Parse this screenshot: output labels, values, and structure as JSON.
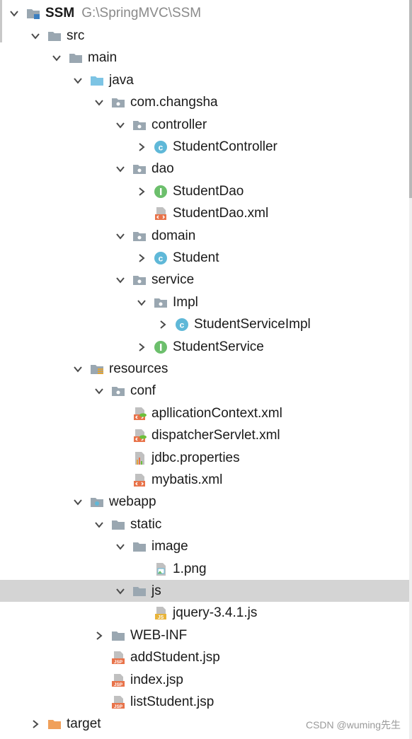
{
  "project": {
    "name": "SSM",
    "path": "G:\\SpringMVC\\SSM"
  },
  "tree": [
    {
      "label": "src",
      "depth": 1,
      "state": "open",
      "icon": "folder-icon"
    },
    {
      "label": "main",
      "depth": 2,
      "state": "open",
      "icon": "folder-icon"
    },
    {
      "label": "java",
      "depth": 3,
      "state": "open",
      "icon": "source-folder-icon"
    },
    {
      "label": "com.changsha",
      "depth": 4,
      "state": "open",
      "icon": "package-icon"
    },
    {
      "label": "controller",
      "depth": 5,
      "state": "open",
      "icon": "package-icon"
    },
    {
      "label": "StudentController",
      "depth": 6,
      "state": "closed",
      "icon": "class-icon"
    },
    {
      "label": "dao",
      "depth": 5,
      "state": "open",
      "icon": "package-icon"
    },
    {
      "label": "StudentDao",
      "depth": 6,
      "state": "closed",
      "icon": "interface-icon"
    },
    {
      "label": "StudentDao.xml",
      "depth": 6,
      "state": "leaf",
      "icon": "xml-file-icon"
    },
    {
      "label": "domain",
      "depth": 5,
      "state": "open",
      "icon": "package-icon"
    },
    {
      "label": "Student",
      "depth": 6,
      "state": "closed",
      "icon": "class-icon"
    },
    {
      "label": "service",
      "depth": 5,
      "state": "open",
      "icon": "package-icon"
    },
    {
      "label": "Impl",
      "depth": 6,
      "state": "open",
      "icon": "package-icon"
    },
    {
      "label": "StudentServiceImpl",
      "depth": 7,
      "state": "closed",
      "icon": "class-icon"
    },
    {
      "label": "StudentService",
      "depth": 6,
      "state": "closed",
      "icon": "interface-icon"
    },
    {
      "label": "resources",
      "depth": 3,
      "state": "open",
      "icon": "resources-folder-icon"
    },
    {
      "label": "conf",
      "depth": 4,
      "state": "open",
      "icon": "package-icon"
    },
    {
      "label": "apllicationContext.xml",
      "depth": 5,
      "state": "leaf",
      "icon": "spring-xml-icon"
    },
    {
      "label": "dispatcherServlet.xml",
      "depth": 5,
      "state": "leaf",
      "icon": "spring-xml-icon"
    },
    {
      "label": "jdbc.properties",
      "depth": 5,
      "state": "leaf",
      "icon": "properties-file-icon"
    },
    {
      "label": "mybatis.xml",
      "depth": 5,
      "state": "leaf",
      "icon": "xml-file-icon"
    },
    {
      "label": "webapp",
      "depth": 3,
      "state": "open",
      "icon": "web-folder-icon"
    },
    {
      "label": "static",
      "depth": 4,
      "state": "open",
      "icon": "folder-icon"
    },
    {
      "label": "image",
      "depth": 5,
      "state": "open",
      "icon": "folder-icon"
    },
    {
      "label": "1.png",
      "depth": 6,
      "state": "leaf",
      "icon": "image-file-icon"
    },
    {
      "label": "js",
      "depth": 5,
      "state": "open",
      "icon": "folder-icon",
      "selected": true
    },
    {
      "label": "jquery-3.4.1.js",
      "depth": 6,
      "state": "leaf",
      "icon": "js-file-icon"
    },
    {
      "label": "WEB-INF",
      "depth": 4,
      "state": "closed",
      "icon": "folder-icon"
    },
    {
      "label": "addStudent.jsp",
      "depth": 4,
      "state": "leaf",
      "icon": "jsp-file-icon"
    },
    {
      "label": "index.jsp",
      "depth": 4,
      "state": "leaf",
      "icon": "jsp-file-icon"
    },
    {
      "label": "listStudent.jsp",
      "depth": 4,
      "state": "leaf",
      "icon": "jsp-file-icon"
    },
    {
      "label": "target",
      "depth": 1,
      "state": "closed",
      "icon": "excluded-folder-icon"
    }
  ],
  "watermark": "CSDN @wuming先生",
  "colors": {
    "folder": "#9aa7b1",
    "source_folder": "#7dc4e4",
    "excluded_folder": "#f0a05a",
    "class": "#5fb8d8",
    "interface": "#6cbf6c",
    "selection": "#d4d4d4"
  }
}
